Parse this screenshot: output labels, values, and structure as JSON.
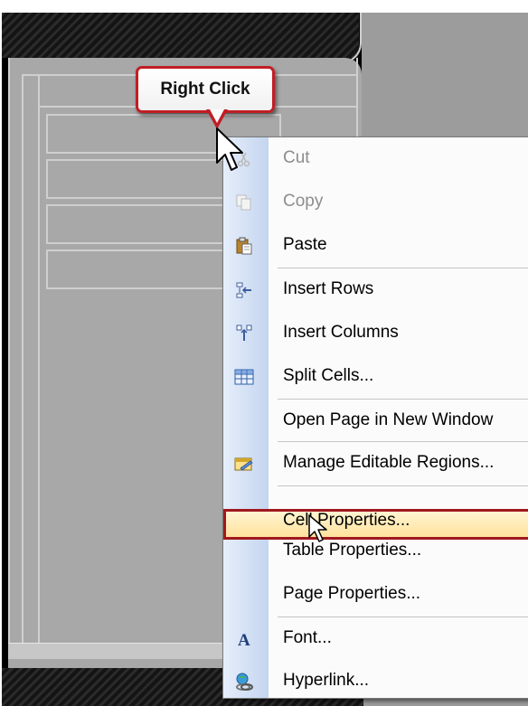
{
  "callout": {
    "text": "Right Click"
  },
  "menu": {
    "items": [
      {
        "label": "Cut",
        "icon": "scissors-icon",
        "disabled": true
      },
      {
        "label": "Copy",
        "icon": "copy-icon",
        "disabled": true
      },
      {
        "label": "Paste",
        "icon": "paste-icon",
        "disabled": false
      },
      {
        "label": "Insert Rows",
        "icon": "insert-rows-icon",
        "disabled": false
      },
      {
        "label": "Insert Columns",
        "icon": "insert-columns-icon",
        "disabled": false
      },
      {
        "label": "Split Cells...",
        "icon": "split-cells-icon",
        "disabled": false
      },
      {
        "label": "Open Page in New Window",
        "icon": "",
        "disabled": false
      },
      {
        "label": "Manage Editable Regions...",
        "icon": "editable-regions-icon",
        "disabled": false
      },
      {
        "label": "Cell Properties...",
        "icon": "",
        "disabled": false,
        "highlighted": true
      },
      {
        "label": "Table Properties...",
        "icon": "",
        "disabled": false
      },
      {
        "label": "Page Properties...",
        "icon": "",
        "disabled": false
      },
      {
        "label": "Font...",
        "icon": "font-icon",
        "disabled": false
      },
      {
        "label": "Hyperlink...",
        "icon": "hyperlink-icon",
        "disabled": false
      }
    ]
  },
  "colors": {
    "callout_border": "#c01e24",
    "highlight_border": "#a0181f",
    "highlight_fill": "#ffe7a6",
    "menu_gutter": "#c4d5ef"
  }
}
